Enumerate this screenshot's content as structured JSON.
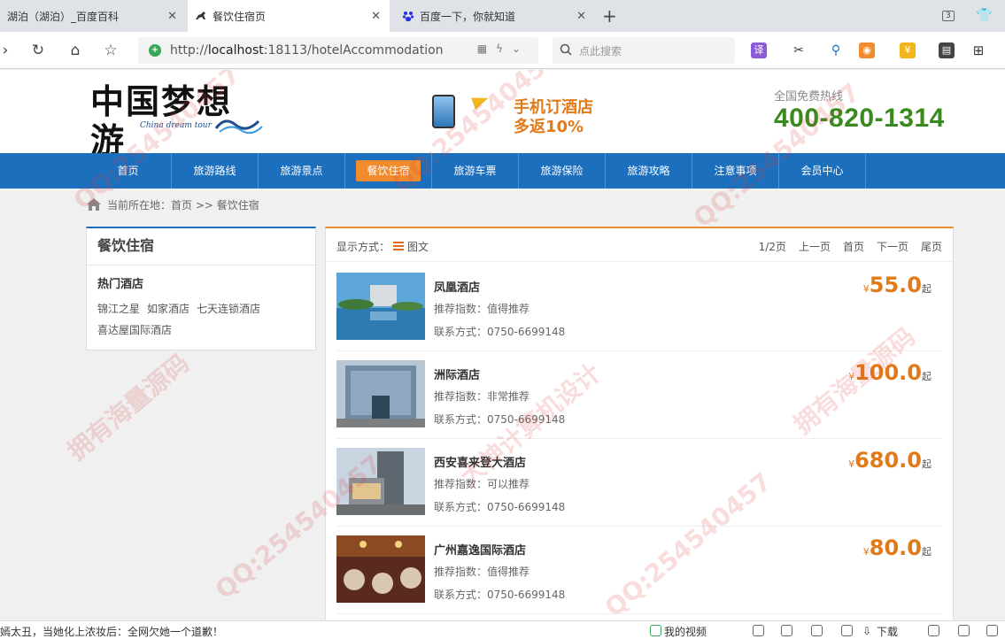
{
  "tabs": [
    {
      "title": "湖泊（湖泊）_百度百科"
    },
    {
      "title": "餐饮住宿页"
    },
    {
      "title": "百度一下，你就知道"
    }
  ],
  "tab_count": "3",
  "address_bar": {
    "url_prefix": "http://",
    "url_host": "localhost",
    "url_rest": ":18113/hotelAccommodation"
  },
  "search": {
    "placeholder": "点此搜索"
  },
  "site": {
    "logo_cn": "中国梦想游",
    "logo_en": "China dream tour",
    "promo_line1": "手机订酒店",
    "promo_line2": "多返10%",
    "hotline_label": "全国免费热线",
    "hotline_number": "400-820-1314"
  },
  "nav": [
    "首页",
    "旅游路线",
    "旅游景点",
    "餐饮住宿",
    "旅游车票",
    "旅游保险",
    "旅游攻略",
    "注意事项",
    "会员中心"
  ],
  "nav_active_index": 3,
  "breadcrumb": "当前所在地：首页 >> 餐饮住宿",
  "sidebar": {
    "title": "餐饮住宿",
    "subtitle": "热门酒店",
    "links": [
      "锦江之星",
      "如家酒店",
      "七天连锁酒店",
      "喜达屋国际酒店"
    ]
  },
  "toolbar": {
    "mode_label": "显示方式：",
    "mode_value": "图文",
    "page_info": "1/2页",
    "prev": "上一页",
    "first": "首页",
    "next": "下一页",
    "last": "尾页"
  },
  "hotels": [
    {
      "name": "凤凰酒店",
      "recommend": "推荐指数：值得推荐",
      "contact": "联系方式：0750-6699148",
      "price": "55.0",
      "currency": "¥",
      "suffix": "起"
    },
    {
      "name": "洲际酒店",
      "recommend": "推荐指数：非常推荐",
      "contact": "联系方式：0750-6699148",
      "price": "100.0",
      "currency": "¥",
      "suffix": "起"
    },
    {
      "name": "西安喜来登大酒店",
      "recommend": "推荐指数：可以推荐",
      "contact": "联系方式：0750-6699148",
      "price": "680.0",
      "currency": "¥",
      "suffix": "起"
    },
    {
      "name": "广州嘉逸国际酒店",
      "recommend": "推荐指数：值得推荐",
      "contact": "联系方式：0750-6699148",
      "price": "80.0",
      "currency": "¥",
      "suffix": "起"
    }
  ],
  "statusbar": {
    "news": "嫣太丑，当她化上浓妆后：全网欠她一个道歉！",
    "video": "我的视频",
    "download": "下载"
  },
  "watermarks": [
    "QQ:254540457",
    "拥有海量源码",
    "大神计算机设计"
  ],
  "colors": {
    "nav_blue": "#1b6fbd",
    "accent_orange": "#f08c2e",
    "price_orange": "#e17a19",
    "hotline_green": "#3b8a1f"
  }
}
